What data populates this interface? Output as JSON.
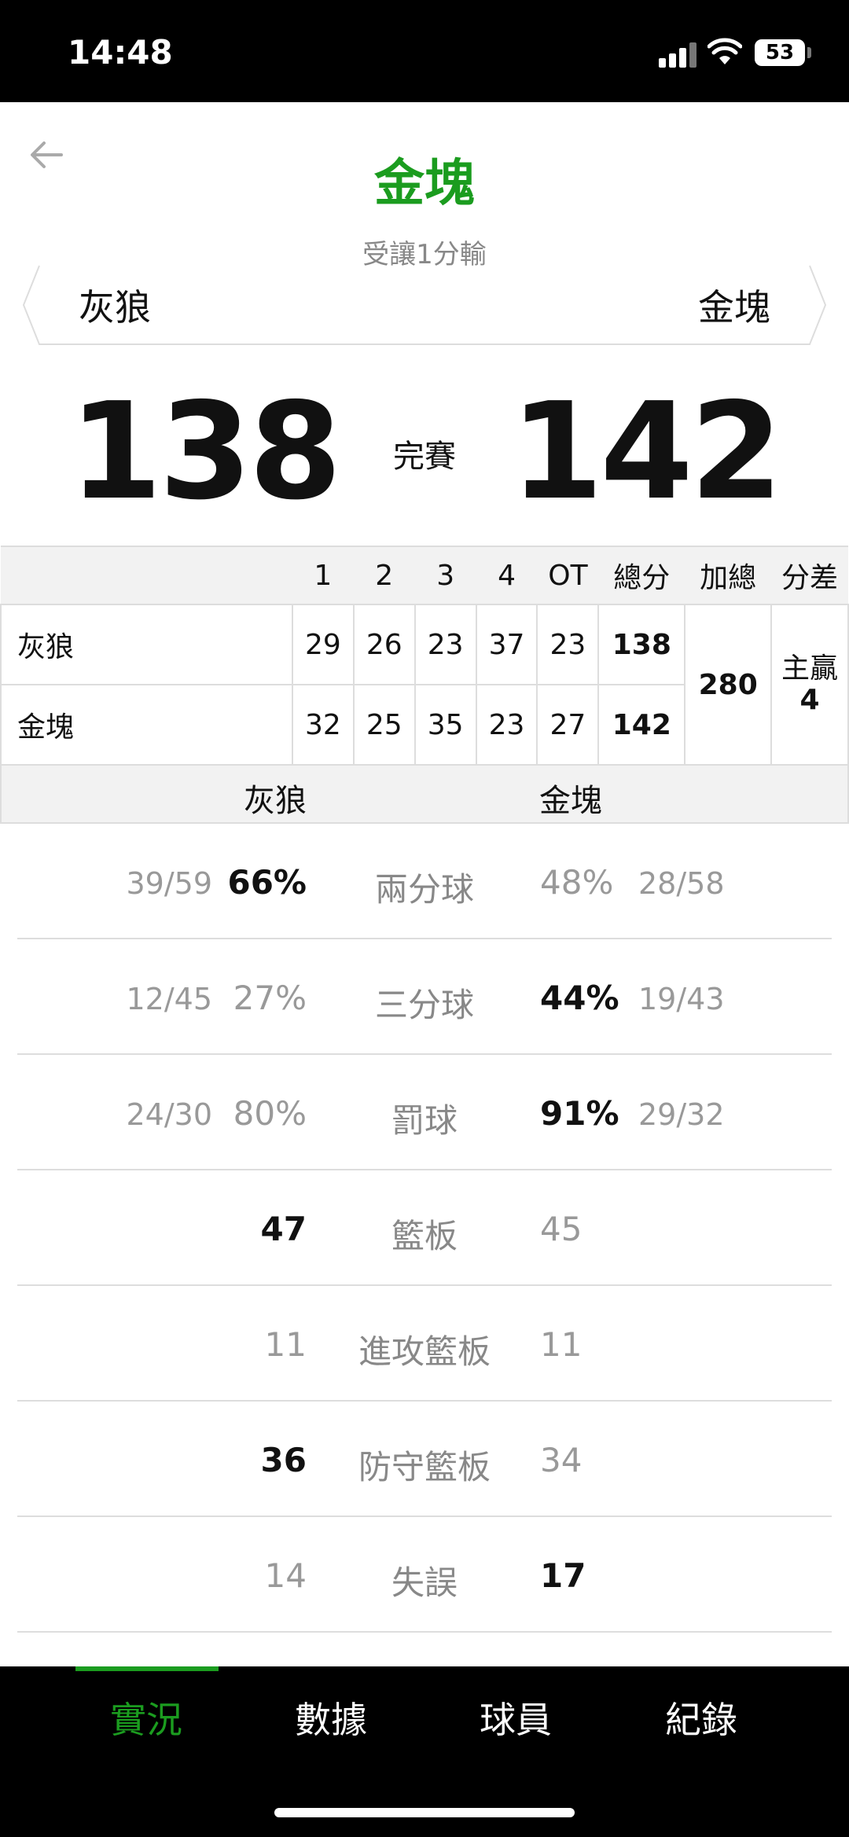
{
  "status_bar": {
    "time": "14:48",
    "battery": "53"
  },
  "header": {
    "title": "金塊",
    "subtitle": "受讓1分輸",
    "left_team": "灰狼",
    "right_team": "金塊"
  },
  "score": {
    "left": "138",
    "right": "142",
    "status": "完賽"
  },
  "quarters": {
    "headers": [
      "1",
      "2",
      "3",
      "4",
      "OT",
      "總分",
      "加總",
      "分差"
    ],
    "rows": [
      {
        "team": "灰狼",
        "q": [
          "29",
          "26",
          "23",
          "37",
          "23"
        ],
        "total": "138"
      },
      {
        "team": "金塊",
        "q": [
          "32",
          "25",
          "35",
          "23",
          "27"
        ],
        "total": "142"
      }
    ],
    "sum": "280",
    "diff_label": "主贏",
    "diff_value": "4"
  },
  "stats_header": {
    "left": "灰狼",
    "right": "金塊"
  },
  "stats": [
    {
      "label": "兩分球",
      "left_frac": "39/59",
      "left_val": "66%",
      "right_val": "48%",
      "right_frac": "28/58"
    },
    {
      "label": "三分球",
      "left_frac": "12/45",
      "left_val": "27%",
      "right_val": "44%",
      "right_frac": "19/43"
    },
    {
      "label": "罰球",
      "left_frac": "24/30",
      "left_val": "80%",
      "right_val": "91%",
      "right_frac": "29/32"
    },
    {
      "label": "籃板",
      "left_frac": "",
      "left_val": "47",
      "right_val": "45",
      "right_frac": ""
    },
    {
      "label": "進攻籃板",
      "left_frac": "",
      "left_val": "11",
      "right_val": "11",
      "right_frac": ""
    },
    {
      "label": "防守籃板",
      "left_frac": "",
      "left_val": "36",
      "right_val": "34",
      "right_frac": ""
    },
    {
      "label": "失誤",
      "left_frac": "",
      "left_val": "14",
      "right_val": "17",
      "right_frac": ""
    }
  ],
  "tabs": [
    "實況",
    "數據",
    "球員",
    "紀錄"
  ],
  "colors": {
    "accent": "#1b9c1f"
  }
}
